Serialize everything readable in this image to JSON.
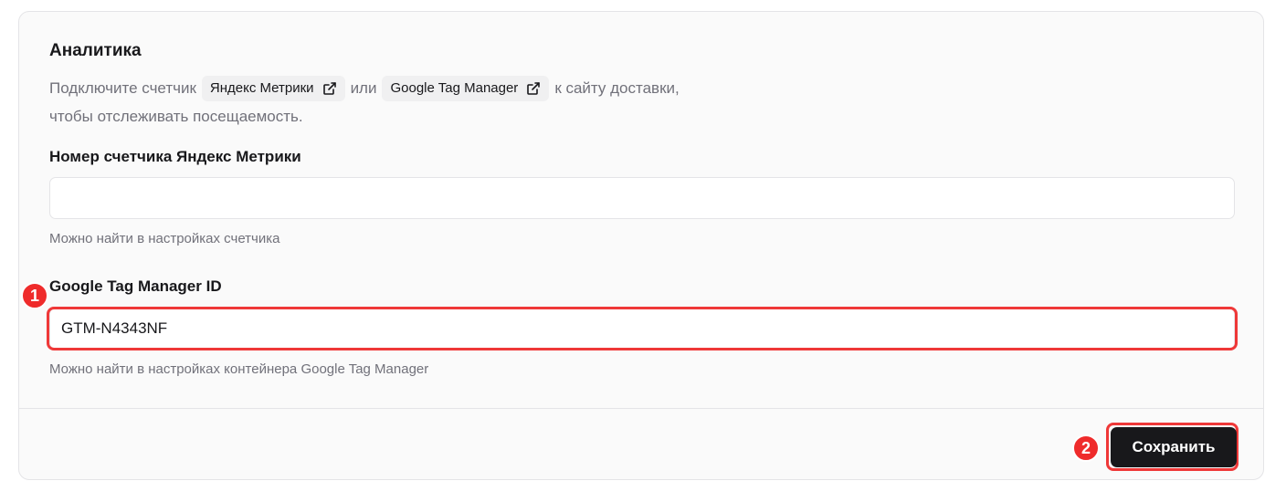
{
  "section": {
    "title": "Аналитика",
    "description_before": "Подключите счетчик",
    "description_between": "или",
    "description_after": "к сайту доставки,",
    "description_line2": "чтобы отслеживать посещаемость.",
    "links": [
      {
        "label": "Яндекс Метрики",
        "icon": "external-link-icon"
      },
      {
        "label": "Google Tag Manager",
        "icon": "external-link-icon"
      }
    ]
  },
  "fields": {
    "yandex": {
      "label": "Номер счетчика Яндекс Метрики",
      "value": "",
      "hint": "Можно найти в настройках счетчика"
    },
    "gtm": {
      "label": "Google Tag Manager ID",
      "value": "GTM-N4343NF",
      "hint": "Можно найти в настройках контейнера Google Tag Manager"
    }
  },
  "footer": {
    "save_label": "Сохранить"
  },
  "annotations": {
    "badge_1": "1",
    "badge_2": "2",
    "highlight_color": "#ef3838"
  },
  "colors": {
    "primary_button": "#18181b",
    "muted_text": "#71717a",
    "card_background": "#fafafa"
  }
}
